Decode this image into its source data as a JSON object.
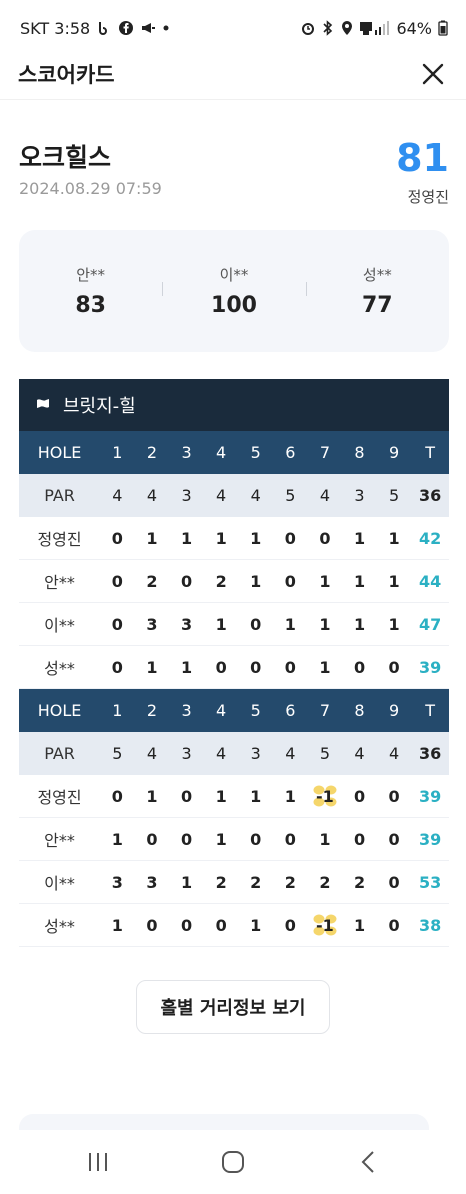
{
  "status_bar": {
    "carrier_time": "SKT 3:58",
    "battery": "64%"
  },
  "header": {
    "title": "스코어카드"
  },
  "course": {
    "name": "오크힐스",
    "datetime": "2024.08.29 07:59",
    "my_score": "81",
    "my_name": "정영진"
  },
  "others": [
    {
      "name": "안**",
      "score": "83"
    },
    {
      "name": "이**",
      "score": "100"
    },
    {
      "name": "성**",
      "score": "77"
    }
  ],
  "scorecard": {
    "course_name": "브릿지-힐",
    "hole_label": "HOLE",
    "par_label": "PAR",
    "total_label": "T",
    "front": {
      "holes": [
        "1",
        "2",
        "3",
        "4",
        "5",
        "6",
        "7",
        "8",
        "9"
      ],
      "par": [
        "4",
        "4",
        "3",
        "4",
        "4",
        "5",
        "4",
        "3",
        "5"
      ],
      "par_total": "36",
      "players": [
        {
          "name": "정영진",
          "scores": [
            "0",
            "1",
            "1",
            "1",
            "1",
            "0",
            "0",
            "1",
            "1"
          ],
          "total": "42"
        },
        {
          "name": "안**",
          "scores": [
            "0",
            "2",
            "0",
            "2",
            "1",
            "0",
            "1",
            "1",
            "1"
          ],
          "total": "44"
        },
        {
          "name": "이**",
          "scores": [
            "0",
            "3",
            "3",
            "1",
            "0",
            "1",
            "1",
            "1",
            "1"
          ],
          "total": "47"
        },
        {
          "name": "성**",
          "scores": [
            "0",
            "1",
            "1",
            "0",
            "0",
            "0",
            "1",
            "0",
            "0"
          ],
          "total": "39"
        }
      ]
    },
    "back": {
      "holes": [
        "1",
        "2",
        "3",
        "4",
        "5",
        "6",
        "7",
        "8",
        "9"
      ],
      "par": [
        "5",
        "4",
        "3",
        "4",
        "3",
        "4",
        "5",
        "4",
        "4"
      ],
      "par_total": "36",
      "players": [
        {
          "name": "정영진",
          "scores": [
            "0",
            "1",
            "0",
            "1",
            "1",
            "1",
            "-1",
            "0",
            "0"
          ],
          "total": "39"
        },
        {
          "name": "안**",
          "scores": [
            "1",
            "0",
            "0",
            "1",
            "0",
            "0",
            "1",
            "0",
            "0"
          ],
          "total": "39"
        },
        {
          "name": "이**",
          "scores": [
            "3",
            "3",
            "1",
            "2",
            "2",
            "2",
            "2",
            "2",
            "0"
          ],
          "total": "53"
        },
        {
          "name": "성**",
          "scores": [
            "1",
            "0",
            "0",
            "0",
            "1",
            "0",
            "-1",
            "1",
            "0"
          ],
          "total": "38"
        }
      ]
    }
  },
  "distance_button": "홀별 거리정보 보기",
  "colors": {
    "accent": "#2f8ff0",
    "total": "#2bb0c3",
    "hole_row": "#244a6c",
    "course_row": "#1a2b3c",
    "birdie": "#f5d66b"
  },
  "icons": [
    "flag-icon",
    "close-icon",
    "birdie-icon",
    "recent-apps-icon",
    "home-icon",
    "back-icon"
  ]
}
